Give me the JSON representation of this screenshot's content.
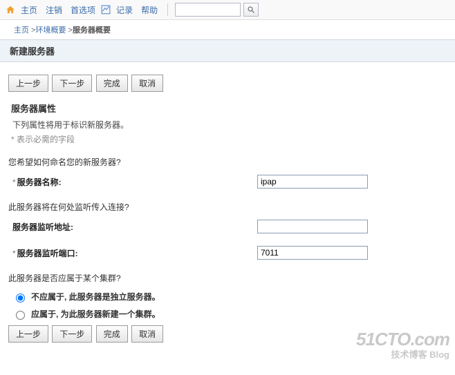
{
  "nav": {
    "home": "主页",
    "logout": "注销",
    "prefs": "首选项",
    "record": "记录",
    "help": "帮助"
  },
  "breadcrumb": {
    "home": "主页",
    "env": "环境概要",
    "current": "服务器概要"
  },
  "page_title": "新建服务器",
  "buttons": {
    "prev": "上一步",
    "next": "下一步",
    "finish": "完成",
    "cancel": "取消"
  },
  "section": {
    "heading": "服务器属性",
    "desc": "下列属性将用于标识新服务器。",
    "hint": "* 表示必需的字段"
  },
  "q1": "您希望如何命名您的新服务器?",
  "field_name": {
    "label": "服务器名称:",
    "value": "ipap"
  },
  "q2": "此服务器将在何处监听传入连接?",
  "field_addr": {
    "label": "服务器监听地址:",
    "value": ""
  },
  "field_port": {
    "label": "服务器监听端口:",
    "value": "7011"
  },
  "q3": "此服务器是否应属于某个集群?",
  "radio": {
    "standalone": "不应属于, 此服务器是独立服务器。",
    "cluster": "应属于, 为此服务器新建一个集群。"
  },
  "watermark": {
    "line1": "51CTO.com",
    "line2": "技术博客   Blog"
  }
}
